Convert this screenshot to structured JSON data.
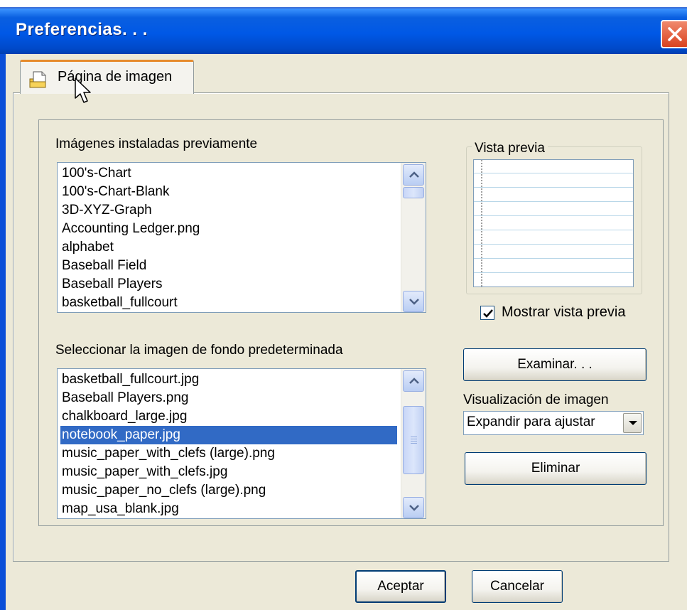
{
  "window": {
    "title": "Preferencias. . .",
    "tab_label": "Página de imagen"
  },
  "installed": {
    "label": "Imágenes instaladas previamente",
    "items": [
      "100's-Chart",
      "100's-Chart-Blank",
      "3D-XYZ-Graph",
      "Accounting Ledger.png",
      "alphabet",
      "Baseball Field",
      "Baseball Players",
      "basketball_fullcourt"
    ]
  },
  "default_bg": {
    "label": "Seleccionar la imagen de fondo predeterminada",
    "items": [
      "basketball_fullcourt.jpg",
      "Baseball Players.png",
      "chalkboard_large.jpg",
      "notebook_paper.jpg",
      "music_paper_with_clefs (large).png",
      "music_paper_with_clefs.jpg",
      "music_paper_no_clefs (large).png",
      "map_usa_blank.jpg"
    ],
    "selected": "notebook_paper.jpg"
  },
  "preview": {
    "legend": "Vista previa",
    "show_label": "Mostrar vista previa",
    "show_checked": true
  },
  "buttons": {
    "browse": "Examinar. . .",
    "remove": "Eliminar",
    "ok": "Aceptar",
    "cancel": "Cancelar"
  },
  "display": {
    "label": "Visualización de imagen",
    "value": "Expandir para ajustar"
  },
  "colors": {
    "titlebar": "#0058e6",
    "selection": "#316ac5",
    "close": "#d9421f"
  },
  "icons": [
    "page-icon",
    "mouse-pointer-icon",
    "close-icon",
    "checkmark-icon",
    "chevron-up-icon",
    "chevron-down-icon",
    "dropdown-arrow-icon"
  ]
}
